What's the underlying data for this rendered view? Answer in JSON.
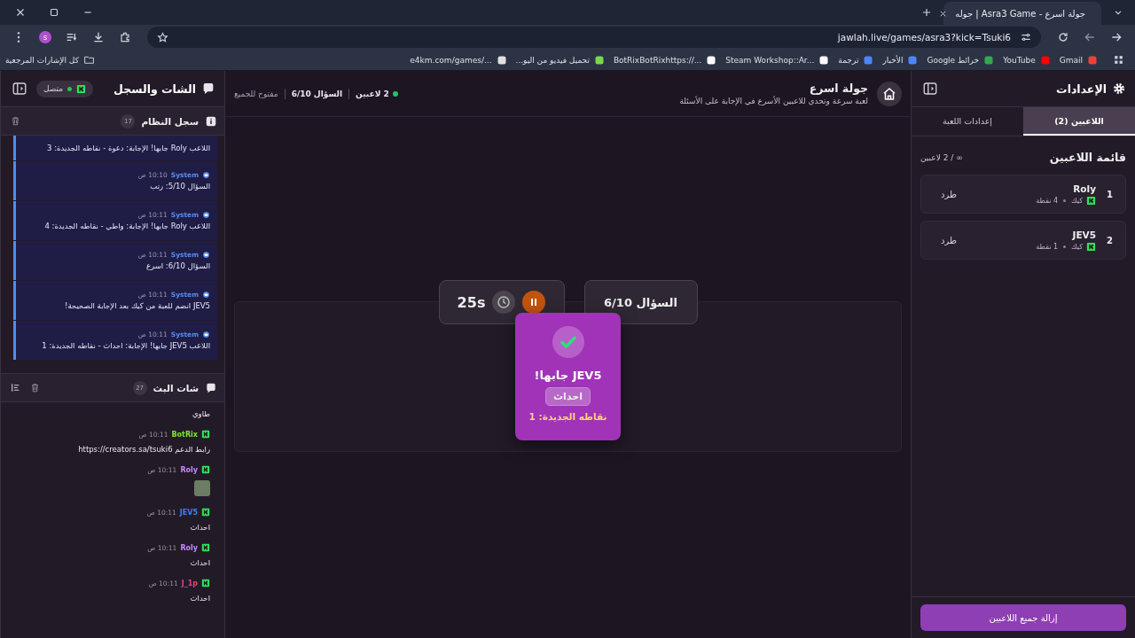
{
  "browser": {
    "tab": {
      "title": "جولة اسرع - Asra3 Game | جوله"
    },
    "url": "jawlah.live/games/asra3?kick=Tsuki6",
    "profile": "s",
    "bookmarks": [
      {
        "label": "Gmail"
      },
      {
        "label": "YouTube"
      },
      {
        "label": "خرائط Google"
      },
      {
        "label": "الأخبار"
      },
      {
        "label": "ترجمة"
      },
      {
        "label": "Steam Workshop::Ar..."
      },
      {
        "label": "BotRixBotRixhttps://..."
      },
      {
        "label": "تحميل فيديو من اليو..."
      },
      {
        "label": "e4km.com/games/..."
      }
    ],
    "all_bookmarks": "كل الإشارات المرجعية"
  },
  "settings": {
    "title": "الإعدادات",
    "tabs": [
      {
        "label": "اللاعبين (2)",
        "selected": true
      },
      {
        "label": "إعدادات اللعبة",
        "selected": false
      }
    ],
    "players_heading": "قائمة اللاعبين",
    "players_count": "∞ / 2 لاعبين",
    "players": [
      {
        "rank": "1",
        "name": "Roly",
        "platform": "كيك",
        "points": "4 نقطة",
        "kick": "طرد"
      },
      {
        "rank": "2",
        "name": "JEV5",
        "platform": "كيك",
        "points": "1 نقطة",
        "kick": "طرد"
      }
    ],
    "remove_all": "إزالة جميع اللاعبين"
  },
  "game": {
    "title": "جولة اسرع",
    "subtitle": "لعبة سرعة وتحدي للاعبين الأسرع في الإجابة على الأسئلة",
    "players_online": "2 لاعبين",
    "question_status": "السؤال 6/10",
    "access": "مفتوح للجميع",
    "question_badge": "السؤال 6/10",
    "timer": "25s",
    "paused": false,
    "winner": {
      "title": "JEV5 جابها!",
      "answer": "احداث",
      "points": "نقاطه الجديدة: 1"
    }
  },
  "chat": {
    "title": "الشات والسجل",
    "connection": "متصل",
    "connected": true,
    "system_log": {
      "title": "سجل النظام",
      "count": "17",
      "entries": [
        {
          "text": "اللاعب Roly جابها! الإجابة: دعوة - نقاطه الجديدة: 3"
        },
        {
          "sender": "System",
          "time": "10:10 ص",
          "text": "السؤال 5/10: رتب"
        },
        {
          "sender": "System",
          "time": "10:11 ص",
          "text": "اللاعب Roly جابها! الإجابة: واطي - نقاطه الجديدة: 4"
        },
        {
          "sender": "System",
          "time": "10:11 ص",
          "text": "السؤال 6/10: اسرع"
        },
        {
          "sender": "System",
          "time": "10:11 ص",
          "text": "JEV5 انضم للعبة من كيك بعد الإجابة الصحيحة!"
        },
        {
          "sender": "System",
          "time": "10:11 ص",
          "text": "اللاعب JEV5 جابها! الإجابة: احداث - نقاطه الجديدة: 1"
        }
      ]
    },
    "stream_chat": {
      "title": "شات البث",
      "count": "27",
      "messages": [
        {
          "kind": "text",
          "text": "طاوي"
        },
        {
          "kind": "text",
          "user": "BotRix",
          "color": "#7ee52f",
          "time": "10:11 ص",
          "text": "رابط الدعم https://creators.sa/tsuki6"
        },
        {
          "kind": "emote",
          "user": "Roly",
          "color": "#c58af9",
          "time": "10:11 ص"
        },
        {
          "kind": "text",
          "user": "JEV5",
          "color": "#3b82f6",
          "time": "10:11 ص",
          "text": "احداث"
        },
        {
          "kind": "text",
          "user": "Roly",
          "color": "#c58af9",
          "time": "10:11 ص",
          "text": "احداث"
        },
        {
          "kind": "text",
          "user": "J_1p",
          "color": "#e0457b",
          "time": "10:11 ص",
          "text": "احداث"
        }
      ]
    }
  }
}
